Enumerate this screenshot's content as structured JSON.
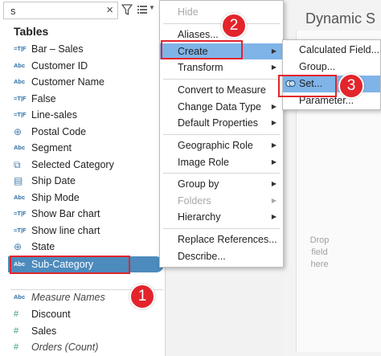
{
  "search": {
    "value": "s"
  },
  "data_pane": {
    "heading": "Tables",
    "fields": [
      {
        "type": "=T|F",
        "name": "Bar – Sales"
      },
      {
        "type": "Abc",
        "name": "Customer ID"
      },
      {
        "type": "Abc",
        "name": "Customer Name"
      },
      {
        "type": "=T|F",
        "name": "False"
      },
      {
        "type": "=T|F",
        "name": "Line-sales"
      },
      {
        "type": "⊕",
        "name": "Postal Code"
      },
      {
        "type": "Abc",
        "name": "Segment"
      },
      {
        "type": "⧉",
        "name": "Selected Category"
      },
      {
        "type": "▤",
        "name": "Ship Date"
      },
      {
        "type": "Abc",
        "name": "Ship Mode"
      },
      {
        "type": "=T|F",
        "name": "Show Bar chart"
      },
      {
        "type": "=T|F",
        "name": "Show line chart"
      },
      {
        "type": "⊕",
        "name": "State"
      }
    ],
    "selected_field": {
      "type": "Abc",
      "name": "Sub-Category"
    },
    "measures": [
      {
        "type": "Abc",
        "name": "Measure Names"
      },
      {
        "type": "#",
        "name": "Discount"
      },
      {
        "type": "#",
        "name": "Sales"
      },
      {
        "type": "#",
        "name": "Orders (Count)"
      }
    ]
  },
  "context_menu": {
    "hide": "Hide",
    "aliases": "Aliases...",
    "create": "Create",
    "transform": "Transform",
    "convert_to_measure": "Convert to Measure",
    "change_data_type": "Change Data Type",
    "default_properties": "Default Properties",
    "geographic_role": "Geographic Role",
    "image_role": "Image Role",
    "group_by": "Group by",
    "folders": "Folders",
    "hierarchy": "Hierarchy",
    "replace_references": "Replace References...",
    "describe": "Describe..."
  },
  "create_submenu": {
    "calculated_field": "Calculated Field...",
    "group": "Group...",
    "set": "Set...",
    "parameter": "Parameter..."
  },
  "sheet": {
    "title": "Dynamic S",
    "drop_line1": "Drop",
    "drop_line2": "field",
    "drop_line3": "here"
  },
  "markers": {
    "one": "1",
    "two": "2",
    "three": "3"
  },
  "colors": {
    "highlight": "#7fb4e8",
    "selected_field": "#4c8bbd",
    "annotation_red": "#e3242b"
  }
}
